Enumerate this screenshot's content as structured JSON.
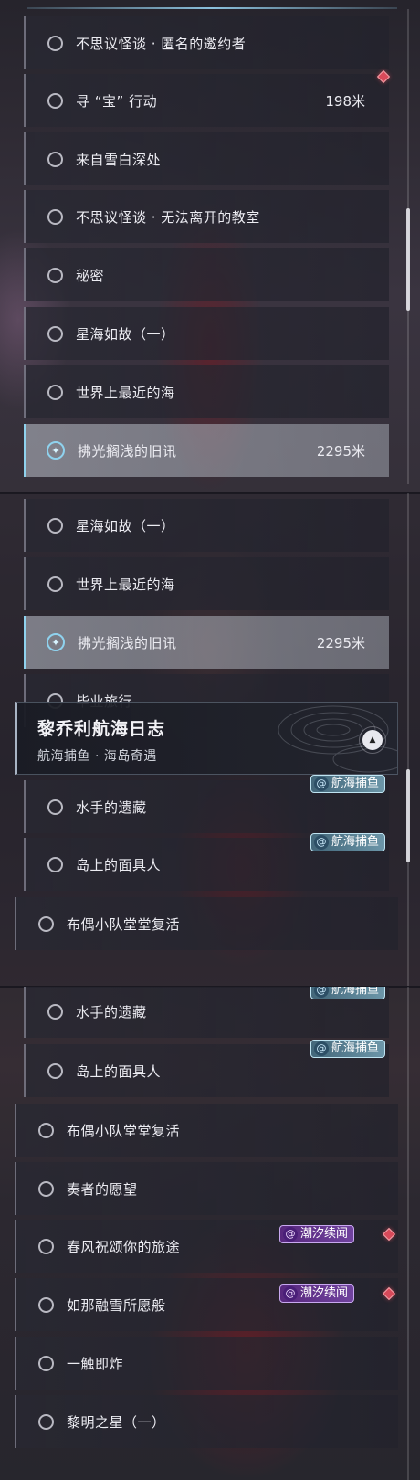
{
  "quests": {
    "anonymous_inviter": "不思议怪谈 · 匿名的邀约者",
    "seek_treasure": "寻 “宝” 行动",
    "seek_treasure_distance": "198米",
    "from_snow": "来自雪白深处",
    "inescapable_classroom": "不思议怪谈 · 无法离开的教室",
    "secret": "秘密",
    "sea_of_stars": "星海如故（一）",
    "nearest_sea": "世界上最近的海",
    "old_news": "拂光搁浅的旧讯",
    "old_news_distance": "2295米",
    "graduation_trip": "毕业旅行",
    "sailor_treasure": "水手的遗藏",
    "island_mask": "岛上的面具人",
    "doll_squad": "布偶小队堂堂复活",
    "player_wish": "奏者的愿望",
    "spring_wind": "春风祝颂你的旅途",
    "melting_snow": "如那融雪所愿般",
    "one_touch": "一触即炸",
    "dawn_star": "黎明之星（一）"
  },
  "category": {
    "title": "黎乔利航海日志",
    "subtitle": "航海捕鱼 · 海岛奇遇"
  },
  "tags": {
    "fishing": "航海捕鱼",
    "tide": "潮汐续闻"
  },
  "colors": {
    "selected_accent": "#8fd2ee",
    "marker_red": "#d84a5a",
    "fishing_tag": "#7fb0c4",
    "tide_tag": "#6a3ca0"
  },
  "icons": {
    "radio": "radio-circle-icon",
    "tracking": "compass-star-icon",
    "collapse": "chevron-up-icon",
    "fishing_tag": "fishing-swirl-icon",
    "tide_tag": "tide-swirl-icon",
    "marker": "red-diamond-marker-icon"
  }
}
